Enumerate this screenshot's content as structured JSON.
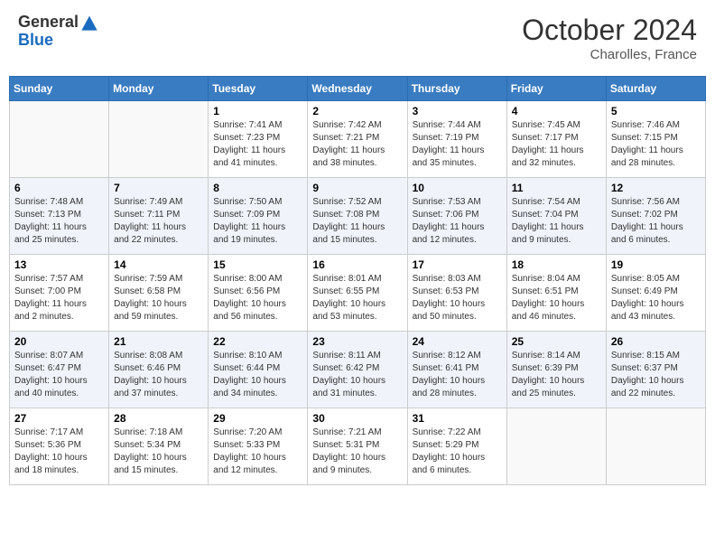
{
  "header": {
    "logo_line1": "General",
    "logo_line2": "Blue",
    "month": "October 2024",
    "location": "Charolles, France"
  },
  "days_of_week": [
    "Sunday",
    "Monday",
    "Tuesday",
    "Wednesday",
    "Thursday",
    "Friday",
    "Saturday"
  ],
  "weeks": [
    [
      {
        "day": "",
        "empty": true
      },
      {
        "day": "",
        "empty": true
      },
      {
        "day": "1",
        "sunrise": "Sunrise: 7:41 AM",
        "sunset": "Sunset: 7:23 PM",
        "daylight": "Daylight: 11 hours and 41 minutes."
      },
      {
        "day": "2",
        "sunrise": "Sunrise: 7:42 AM",
        "sunset": "Sunset: 7:21 PM",
        "daylight": "Daylight: 11 hours and 38 minutes."
      },
      {
        "day": "3",
        "sunrise": "Sunrise: 7:44 AM",
        "sunset": "Sunset: 7:19 PM",
        "daylight": "Daylight: 11 hours and 35 minutes."
      },
      {
        "day": "4",
        "sunrise": "Sunrise: 7:45 AM",
        "sunset": "Sunset: 7:17 PM",
        "daylight": "Daylight: 11 hours and 32 minutes."
      },
      {
        "day": "5",
        "sunrise": "Sunrise: 7:46 AM",
        "sunset": "Sunset: 7:15 PM",
        "daylight": "Daylight: 11 hours and 28 minutes."
      }
    ],
    [
      {
        "day": "6",
        "sunrise": "Sunrise: 7:48 AM",
        "sunset": "Sunset: 7:13 PM",
        "daylight": "Daylight: 11 hours and 25 minutes."
      },
      {
        "day": "7",
        "sunrise": "Sunrise: 7:49 AM",
        "sunset": "Sunset: 7:11 PM",
        "daylight": "Daylight: 11 hours and 22 minutes."
      },
      {
        "day": "8",
        "sunrise": "Sunrise: 7:50 AM",
        "sunset": "Sunset: 7:09 PM",
        "daylight": "Daylight: 11 hours and 19 minutes."
      },
      {
        "day": "9",
        "sunrise": "Sunrise: 7:52 AM",
        "sunset": "Sunset: 7:08 PM",
        "daylight": "Daylight: 11 hours and 15 minutes."
      },
      {
        "day": "10",
        "sunrise": "Sunrise: 7:53 AM",
        "sunset": "Sunset: 7:06 PM",
        "daylight": "Daylight: 11 hours and 12 minutes."
      },
      {
        "day": "11",
        "sunrise": "Sunrise: 7:54 AM",
        "sunset": "Sunset: 7:04 PM",
        "daylight": "Daylight: 11 hours and 9 minutes."
      },
      {
        "day": "12",
        "sunrise": "Sunrise: 7:56 AM",
        "sunset": "Sunset: 7:02 PM",
        "daylight": "Daylight: 11 hours and 6 minutes."
      }
    ],
    [
      {
        "day": "13",
        "sunrise": "Sunrise: 7:57 AM",
        "sunset": "Sunset: 7:00 PM",
        "daylight": "Daylight: 11 hours and 2 minutes."
      },
      {
        "day": "14",
        "sunrise": "Sunrise: 7:59 AM",
        "sunset": "Sunset: 6:58 PM",
        "daylight": "Daylight: 10 hours and 59 minutes."
      },
      {
        "day": "15",
        "sunrise": "Sunrise: 8:00 AM",
        "sunset": "Sunset: 6:56 PM",
        "daylight": "Daylight: 10 hours and 56 minutes."
      },
      {
        "day": "16",
        "sunrise": "Sunrise: 8:01 AM",
        "sunset": "Sunset: 6:55 PM",
        "daylight": "Daylight: 10 hours and 53 minutes."
      },
      {
        "day": "17",
        "sunrise": "Sunrise: 8:03 AM",
        "sunset": "Sunset: 6:53 PM",
        "daylight": "Daylight: 10 hours and 50 minutes."
      },
      {
        "day": "18",
        "sunrise": "Sunrise: 8:04 AM",
        "sunset": "Sunset: 6:51 PM",
        "daylight": "Daylight: 10 hours and 46 minutes."
      },
      {
        "day": "19",
        "sunrise": "Sunrise: 8:05 AM",
        "sunset": "Sunset: 6:49 PM",
        "daylight": "Daylight: 10 hours and 43 minutes."
      }
    ],
    [
      {
        "day": "20",
        "sunrise": "Sunrise: 8:07 AM",
        "sunset": "Sunset: 6:47 PM",
        "daylight": "Daylight: 10 hours and 40 minutes."
      },
      {
        "day": "21",
        "sunrise": "Sunrise: 8:08 AM",
        "sunset": "Sunset: 6:46 PM",
        "daylight": "Daylight: 10 hours and 37 minutes."
      },
      {
        "day": "22",
        "sunrise": "Sunrise: 8:10 AM",
        "sunset": "Sunset: 6:44 PM",
        "daylight": "Daylight: 10 hours and 34 minutes."
      },
      {
        "day": "23",
        "sunrise": "Sunrise: 8:11 AM",
        "sunset": "Sunset: 6:42 PM",
        "daylight": "Daylight: 10 hours and 31 minutes."
      },
      {
        "day": "24",
        "sunrise": "Sunrise: 8:12 AM",
        "sunset": "Sunset: 6:41 PM",
        "daylight": "Daylight: 10 hours and 28 minutes."
      },
      {
        "day": "25",
        "sunrise": "Sunrise: 8:14 AM",
        "sunset": "Sunset: 6:39 PM",
        "daylight": "Daylight: 10 hours and 25 minutes."
      },
      {
        "day": "26",
        "sunrise": "Sunrise: 8:15 AM",
        "sunset": "Sunset: 6:37 PM",
        "daylight": "Daylight: 10 hours and 22 minutes."
      }
    ],
    [
      {
        "day": "27",
        "sunrise": "Sunrise: 7:17 AM",
        "sunset": "Sunset: 5:36 PM",
        "daylight": "Daylight: 10 hours and 18 minutes."
      },
      {
        "day": "28",
        "sunrise": "Sunrise: 7:18 AM",
        "sunset": "Sunset: 5:34 PM",
        "daylight": "Daylight: 10 hours and 15 minutes."
      },
      {
        "day": "29",
        "sunrise": "Sunrise: 7:20 AM",
        "sunset": "Sunset: 5:33 PM",
        "daylight": "Daylight: 10 hours and 12 minutes."
      },
      {
        "day": "30",
        "sunrise": "Sunrise: 7:21 AM",
        "sunset": "Sunset: 5:31 PM",
        "daylight": "Daylight: 10 hours and 9 minutes."
      },
      {
        "day": "31",
        "sunrise": "Sunrise: 7:22 AM",
        "sunset": "Sunset: 5:29 PM",
        "daylight": "Daylight: 10 hours and 6 minutes."
      },
      {
        "day": "",
        "empty": true
      },
      {
        "day": "",
        "empty": true
      }
    ]
  ]
}
